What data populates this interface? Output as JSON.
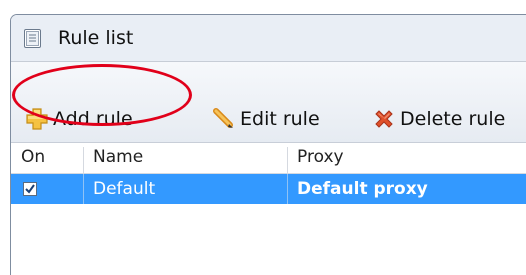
{
  "window": {
    "title": "Rule list"
  },
  "toolbar": {
    "add_label": "Add rule",
    "edit_label": "Edit rule",
    "delete_label": "Delete rule"
  },
  "table": {
    "columns": [
      "On",
      "Name",
      "Proxy"
    ],
    "rows": [
      {
        "on": true,
        "name": "Default",
        "proxy": "Default proxy"
      }
    ]
  },
  "colors": {
    "selection": "#3399ff",
    "annotation_circle": "#e1001a",
    "add_icon": "#f5c242",
    "delete_icon": "#e0502a"
  }
}
